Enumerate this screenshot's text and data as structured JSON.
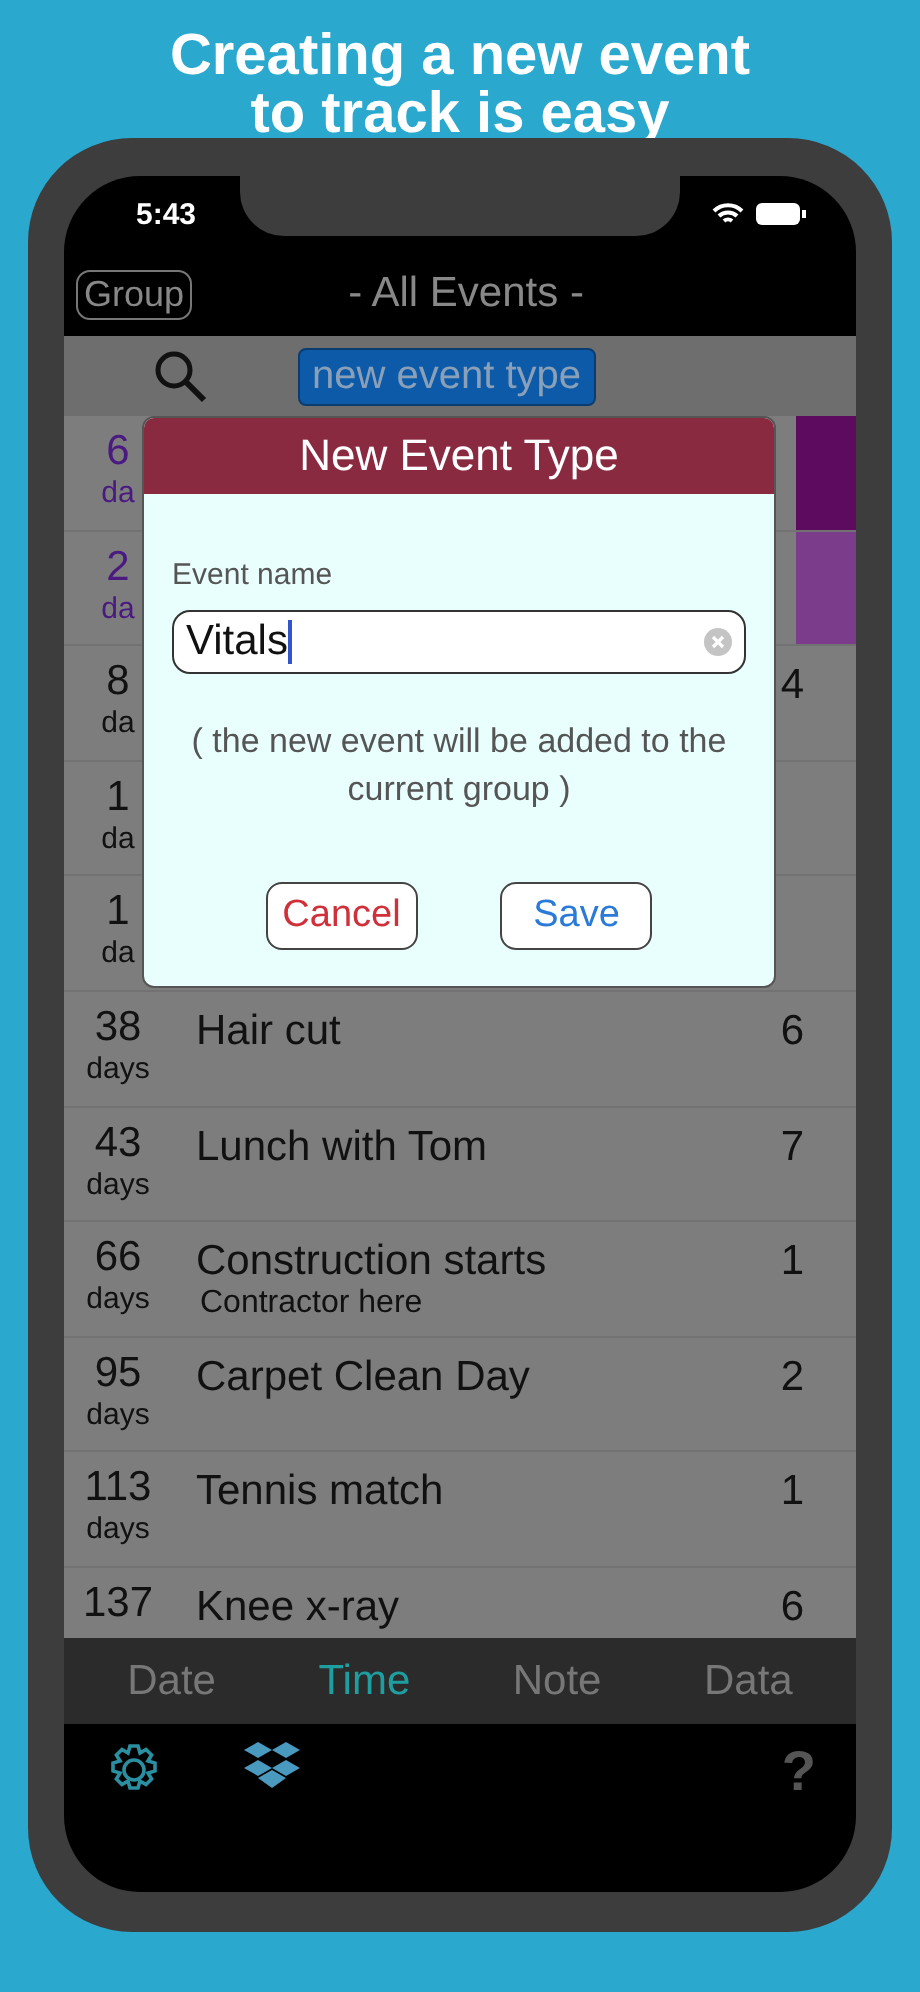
{
  "headline": [
    "Creating a new event",
    "to track is easy"
  ],
  "status_bar": {
    "time": "5:43"
  },
  "nav": {
    "group_button": "Group",
    "title": "- All Events -"
  },
  "search_bar": {
    "new_button": "new event type"
  },
  "events": [
    {
      "days": "6",
      "unit": "da",
      "color": "#5c0b5e"
    },
    {
      "days": "2",
      "unit": "da",
      "color": "#7b3c8c"
    },
    {
      "days": "8",
      "unit": "da",
      "count": "4"
    },
    {
      "days": "1",
      "unit": "da"
    },
    {
      "days": "1",
      "unit": "da"
    },
    {
      "days": "38",
      "unit": "days",
      "name": "Hair cut",
      "count": "6"
    },
    {
      "days": "43",
      "unit": "days",
      "name": "Lunch with Tom",
      "count": "7"
    },
    {
      "days": "66",
      "unit": "days",
      "name": "Construction starts",
      "note": "Contractor here",
      "count": "1"
    },
    {
      "days": "95",
      "unit": "days",
      "name": "Carpet Clean Day",
      "count": "2"
    },
    {
      "days": "113",
      "unit": "days",
      "name": "Tennis match",
      "count": "1"
    },
    {
      "days": "137",
      "name": "Knee x-ray",
      "count": "6"
    }
  ],
  "dialog": {
    "title": "New Event Type",
    "field_label": "Event name",
    "value": "Vitals",
    "note": "( the new event will be added to the current group )",
    "buttons": [
      {
        "label": "Cancel",
        "kind": "cancel"
      },
      {
        "label": "Save",
        "kind": "save"
      }
    ]
  },
  "tabs": [
    {
      "label": "Date",
      "selected": false
    },
    {
      "label": "Time",
      "selected": true
    },
    {
      "label": "Note",
      "selected": false
    },
    {
      "label": "Data",
      "selected": false
    }
  ],
  "toolbar": {
    "help": "?"
  }
}
